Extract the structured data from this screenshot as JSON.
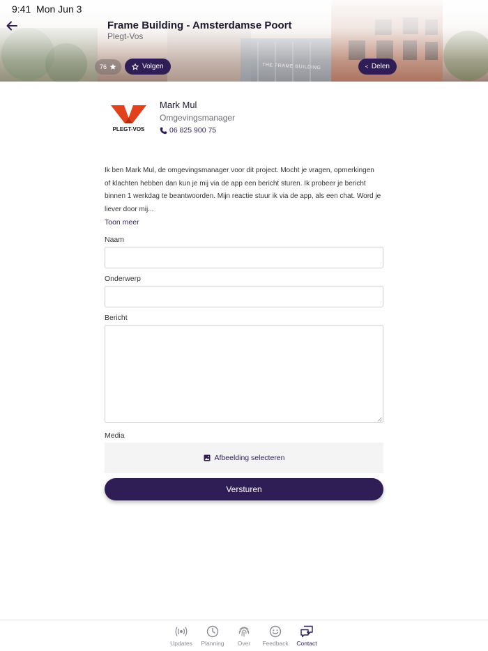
{
  "status_bar": {
    "time": "9:41  Mon Jun 3"
  },
  "header": {
    "title": "Frame Building - Amsterdamse Poort",
    "subtitle": "Plegt-Vos",
    "follower_count": "76",
    "follow_label": "Volgen",
    "share_label": "Delen",
    "building_sign": "THE FRAME BUILDING"
  },
  "contact": {
    "logo_text": "PLEGT-VOS",
    "name": "Mark Mul",
    "role": "Omgevingsmanager",
    "phone": "06 825 900 75"
  },
  "intro": {
    "lines": [
      "Ik ben Mark Mul, de omgevingsmanager voor dit project. Mocht je vragen, opmerkingen",
      "of klachten hebben dan kun je mij via de app een bericht sturen. Ik probeer je bericht",
      "binnen 1 werkdag te beantwoorden. Mijn reactie stuur ik via de app, als een chat. Word je",
      "liever door mij..."
    ],
    "more_label": "Toon meer"
  },
  "form": {
    "name_label": "Naam",
    "name_value": "",
    "subject_label": "Onderwerp",
    "subject_value": "",
    "message_label": "Bericht",
    "message_value": "",
    "media_label": "Media",
    "media_button": "Afbeelding selecteren",
    "submit_label": "Versturen"
  },
  "tabbar": {
    "tabs": [
      {
        "label": "Updates",
        "icon": "broadcast-icon"
      },
      {
        "label": "Planning",
        "icon": "clock-icon"
      },
      {
        "label": "Over",
        "icon": "fingerprint-icon"
      },
      {
        "label": "Feedback",
        "icon": "smiley-icon"
      },
      {
        "label": "Contact",
        "icon": "chat-icon",
        "active": true
      }
    ]
  },
  "colors": {
    "brand": "#2f1d55",
    "logo_red": "#e2421b",
    "muted_text": "#6e6a72",
    "field_border": "#cfcfd3"
  }
}
